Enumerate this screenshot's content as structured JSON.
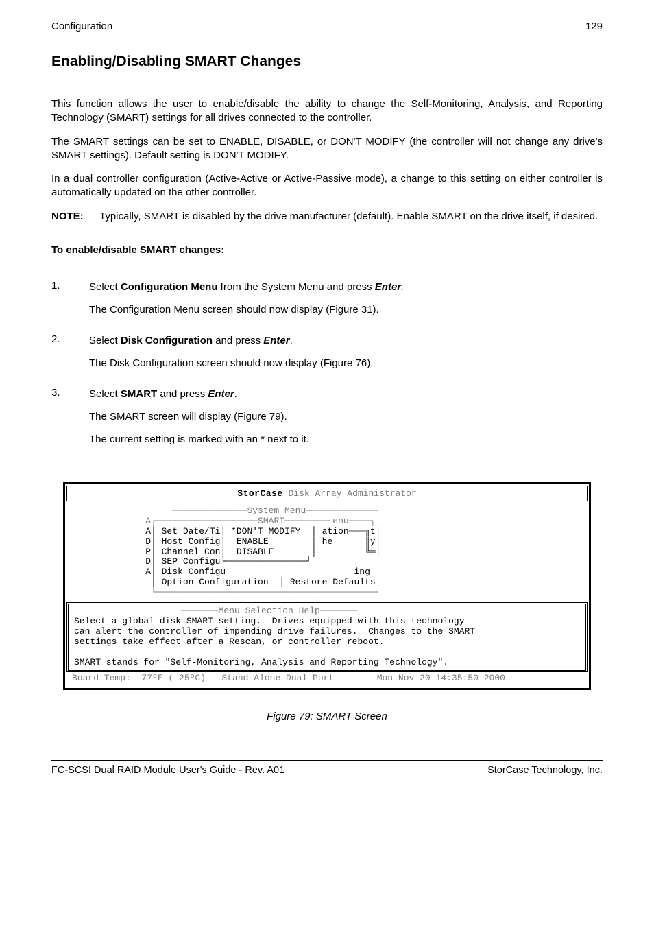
{
  "header": {
    "left": "Configuration",
    "right": "129"
  },
  "title": "Enabling/Disabling SMART Changes",
  "para1": "This function allows the user to enable/disable the ability to change the Self-Monitoring, Analysis, and Reporting Technology (SMART) settings for all drives connected to the controller.",
  "para2": "The SMART settings can be set to ENABLE, DISABLE, or DON'T MODIFY (the controller will not change any drive's SMART settings).  Default setting is DON'T MODIFY.",
  "para3": "In a dual controller configuration (Active-Active or Active-Passive mode), a change to this setting on either controller is automatically updated on the other controller.",
  "note": {
    "label": "NOTE:",
    "text": "Typically, SMART is disabled by the drive manufacturer (default).  Enable SMART on the drive itself, if desired."
  },
  "subhead": "To enable/disable SMART changes:",
  "steps": [
    {
      "num": "1.",
      "lead_a": "Select ",
      "lead_b": "Configuration Menu",
      "lead_c": " from the System Menu and press ",
      "lead_d": "Enter",
      "lead_e": ".",
      "after1": "The Configuration Menu screen should now display (Figure 31)."
    },
    {
      "num": "2.",
      "lead_a": "Select ",
      "lead_b": "Disk Configuration",
      "lead_c": " and press ",
      "lead_d": "Enter",
      "lead_e": ".",
      "after1": "The Disk Configuration screen should now display (Figure 76)."
    },
    {
      "num": "3.",
      "lead_a": "Select ",
      "lead_b": "SMART",
      "lead_c": " and press ",
      "lead_d": "Enter",
      "lead_e": ".",
      "after1": "The SMART screen will display (Figure 79).",
      "after2": "The current setting is marked with an * next to it."
    }
  ],
  "terminal": {
    "title_prefix": "StorCase",
    "title_rest": " Disk Array Administrator",
    "line_sysmenu": "                   ──────────────System Menu─────────────┐",
    "line_smart": "              A┌───────────────────SMART────────┐enu────┐│",
    "line1": "              A│ Set Date/Ti│ *DON'T MODIFY  │ ation═══╗t",
    "line1_tail": "│",
    "line2": "              D│ Host Config│  ENABLE        │ he      ║y",
    "line2_tail": "│",
    "line3": "              P│ Channel Con│  DISABLE       │         ╚═",
    "line3_tail": "│",
    "line4": "              D│ SEP Configu└───────────────┘            │",
    "line5": "              A│ Disk Configu                        ing │",
    "line6": "               │ Option Configuration  │ Restore Defaults│",
    "line7": "               └─────────────────────────────────────────┘",
    "help_title": "                    ───────Menu Selection Help───────",
    "help1": "Select a global disk SMART setting.  Drives equipped with this technology",
    "help2": "can alert the controller of impending drive failures.  Changes to the SMART",
    "help3": "settings take effect after a Rescan, or controller reboot.",
    "help4": "SMART stands for \"Self-Monitoring, Analysis and Reporting Technology\".",
    "footer_left": "Board Temp:  77ºF ( 25ºC)   Stand-Alone Dual Port",
    "footer_right": "Mon Nov 20 14:35:50 2000"
  },
  "figcaption": "Figure 79:   SMART Screen",
  "footer": {
    "left": "FC-SCSI Dual RAID Module User's Guide - Rev. A01",
    "right": "StorCase Technology, Inc."
  }
}
